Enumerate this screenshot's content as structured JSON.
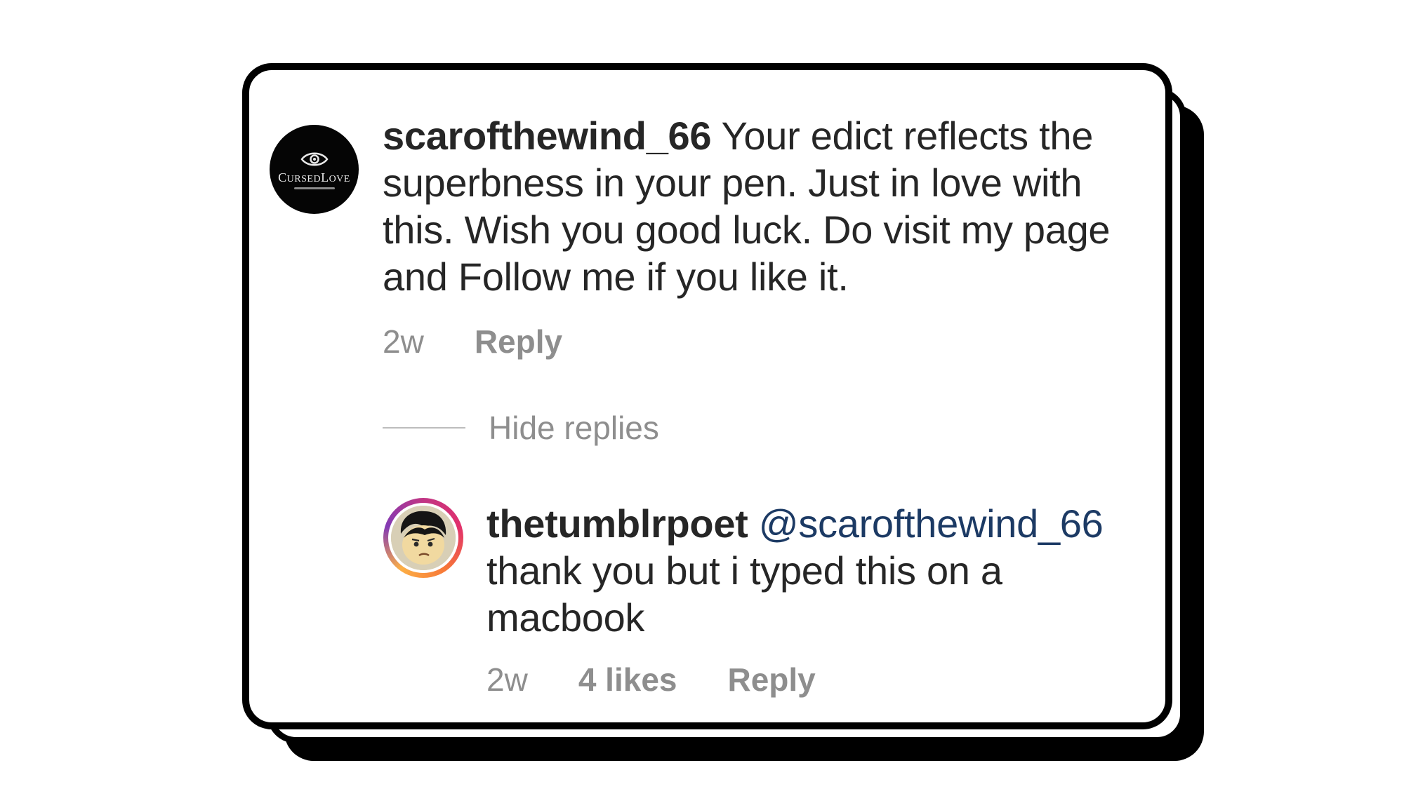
{
  "comment": {
    "username": "scarofthewind_66",
    "text": " Your edict reflects the superbness in your pen. Just in love with this. Wish you good luck. Do visit my page and Follow me if you like it.",
    "time": "2w",
    "reply_label": "Reply",
    "avatar": {
      "icon": "eye-logo-icon",
      "brand_text_big_c": "C",
      "brand_text_rest_1": "URSED",
      "brand_text_big_l": "L",
      "brand_text_rest_2": "OVE"
    }
  },
  "hide_replies_label": "Hide replies",
  "reply": {
    "username": "thetumblrpoet",
    "mention": "@scarofthewind_66",
    "text": "thank you but i typed this on a macbook",
    "time": "2w",
    "likes": "4 likes",
    "reply_label": "Reply",
    "avatar": {
      "icon": "cartoon-face-icon"
    }
  },
  "colors": {
    "text": "#262626",
    "meta": "#8e8e8e",
    "mention": "#1c3a64",
    "card_border": "#000000"
  }
}
